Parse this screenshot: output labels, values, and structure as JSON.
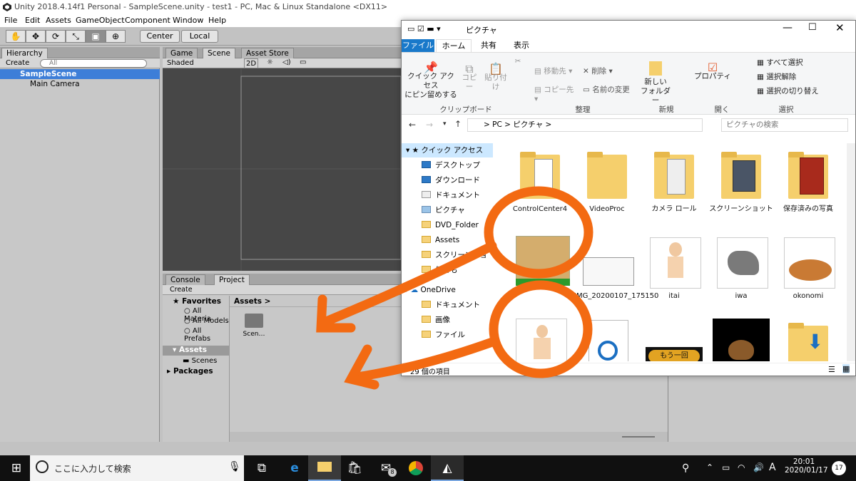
{
  "unity": {
    "title": "Unity 2018.4.14f1 Personal - SampleScene.unity - test1 - PC, Mac & Linux Standalone <DX11>",
    "menu": [
      "File",
      "Edit",
      "Assets",
      "GameObject",
      "Component",
      "Window",
      "Help"
    ],
    "pivot": "Center",
    "space": "Local",
    "hierarchy": {
      "tab": "Hierarchy",
      "create": "Create",
      "search": "All",
      "scene": "SampleScene",
      "items": [
        "Main Camera"
      ]
    },
    "scene": {
      "tabs": [
        "Game",
        "Scene",
        "Asset Store"
      ],
      "shading": "Shaded",
      "mode2d": "2D"
    },
    "project": {
      "tabs": [
        "Console",
        "Project"
      ],
      "create": "Create",
      "favorites": "Favorites",
      "favorite_items": [
        "All Materia",
        "All Models",
        "All Prefabs"
      ],
      "assets_label": "Assets",
      "assets_children": [
        "Scenes"
      ],
      "packages_label": "Packages",
      "breadcrumb": "Assets",
      "asset_items": [
        "Scen…"
      ]
    }
  },
  "explorer": {
    "title": "ピクチャ",
    "ribbon_tabs": [
      "ファイル",
      "ホーム",
      "共有",
      "表示"
    ],
    "ribbon": {
      "pin": "クイック アクセス\nにピン留めする",
      "copy": "コピー",
      "paste": "貼り付け",
      "move_to": "移動先",
      "copy_to": "コピー先",
      "delete": "削除",
      "rename": "名前の変更",
      "new_folder": "新しい\nフォルダー",
      "properties": "プロパティ",
      "select_all": "すべて選択",
      "select_none": "選択解除",
      "invert": "選択の切り替え",
      "groups": [
        "クリップボード",
        "整理",
        "新規",
        "開く",
        "選択"
      ]
    },
    "address": [
      "PC",
      "ピクチャ"
    ],
    "search_placeholder": "ピクチャの検索",
    "nav": {
      "quick_access": "クイック アクセス",
      "quick_items": [
        "デスクトップ",
        "ダウンロード",
        "ドキュメント",
        "ピクチャ",
        "DVD_Folder",
        "Assets",
        "スクリーンショッ",
        "何でも"
      ],
      "onedrive": "OneDrive",
      "onedrive_items": [
        "ドキュメント",
        "画像",
        "ファイル"
      ]
    },
    "files": [
      "ControlCenter4",
      "VideoProc",
      "カメラ ロール",
      "スクリーンショット",
      "保存済みの写真",
      "IMG_20200107_175150",
      "itai",
      "iwa",
      "okonomi"
    ],
    "banner_text": "もう一回",
    "status": "29 個の項目"
  },
  "taskbar": {
    "search_placeholder": "ここに入力して検索",
    "time": "20:01",
    "date": "2020/01/17",
    "ime": "A",
    "mail_badge": "8",
    "notifications": "17"
  },
  "colors": {
    "annotation": "#f36a12",
    "unity_select": "#3d7ed8",
    "explorer_file_tab": "#1979ca"
  }
}
